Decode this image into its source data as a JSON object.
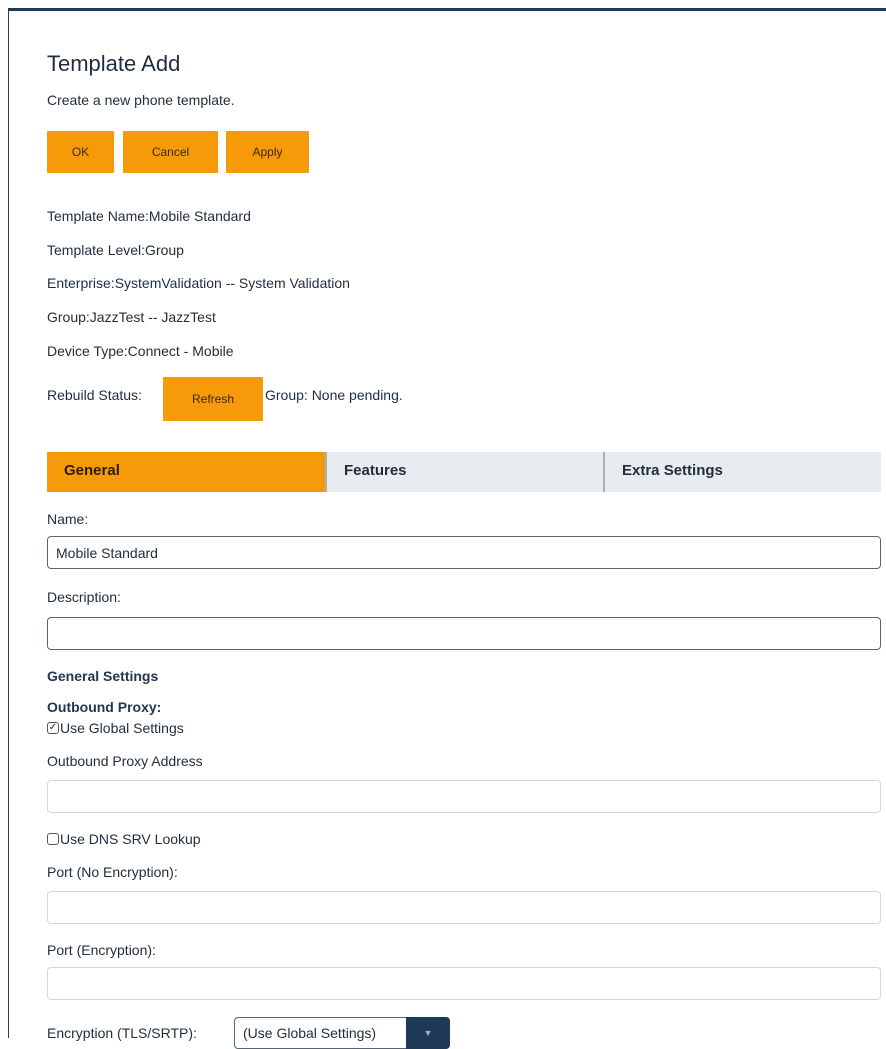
{
  "page": {
    "title": "Template Add",
    "subtitle": "Create a new phone template."
  },
  "actions": {
    "ok_label": "OK",
    "cancel_label": "Cancel",
    "apply_label": "Apply"
  },
  "info": {
    "template_name": "Template Name:Mobile Standard",
    "template_level": "Template Level:Group",
    "enterprise": "Enterprise:SystemValidation -- System Validation",
    "group": "Group:JazzTest -- JazzTest",
    "device_type": "Device Type:Connect - Mobile",
    "rebuild_label": "Rebuild Status:",
    "refresh_label": "Refresh",
    "rebuild_status": "Group: None pending."
  },
  "tabs": [
    {
      "label": "General",
      "active": true
    },
    {
      "label": "Features",
      "active": false
    },
    {
      "label": "Extra Settings",
      "active": false
    }
  ],
  "form": {
    "name_label": "Name:",
    "name_value": "Mobile Standard",
    "description_label": "Description:",
    "description_value": "",
    "general_settings_heading": "General Settings",
    "outbound_proxy_heading": "Outbound Proxy:",
    "use_global_settings_label": "Use Global Settings",
    "use_global_settings_checked": true,
    "outbound_proxy_address_label": "Outbound Proxy Address",
    "outbound_proxy_address_value": "",
    "use_dns_srv_label": "Use DNS SRV Lookup",
    "use_dns_srv_checked": false,
    "port_no_encryption_label": "Port (No Encryption):",
    "port_no_encryption_value": "",
    "port_encryption_label": "Port (Encryption):",
    "port_encryption_value": "",
    "encryption_label": "Encryption (TLS/SRTP):",
    "encryption_selected": "(Use Global Settings)"
  },
  "colors": {
    "accent": "#f79a0a",
    "navy": "#1e3a56",
    "tab_bg": "#e8ecf0"
  }
}
